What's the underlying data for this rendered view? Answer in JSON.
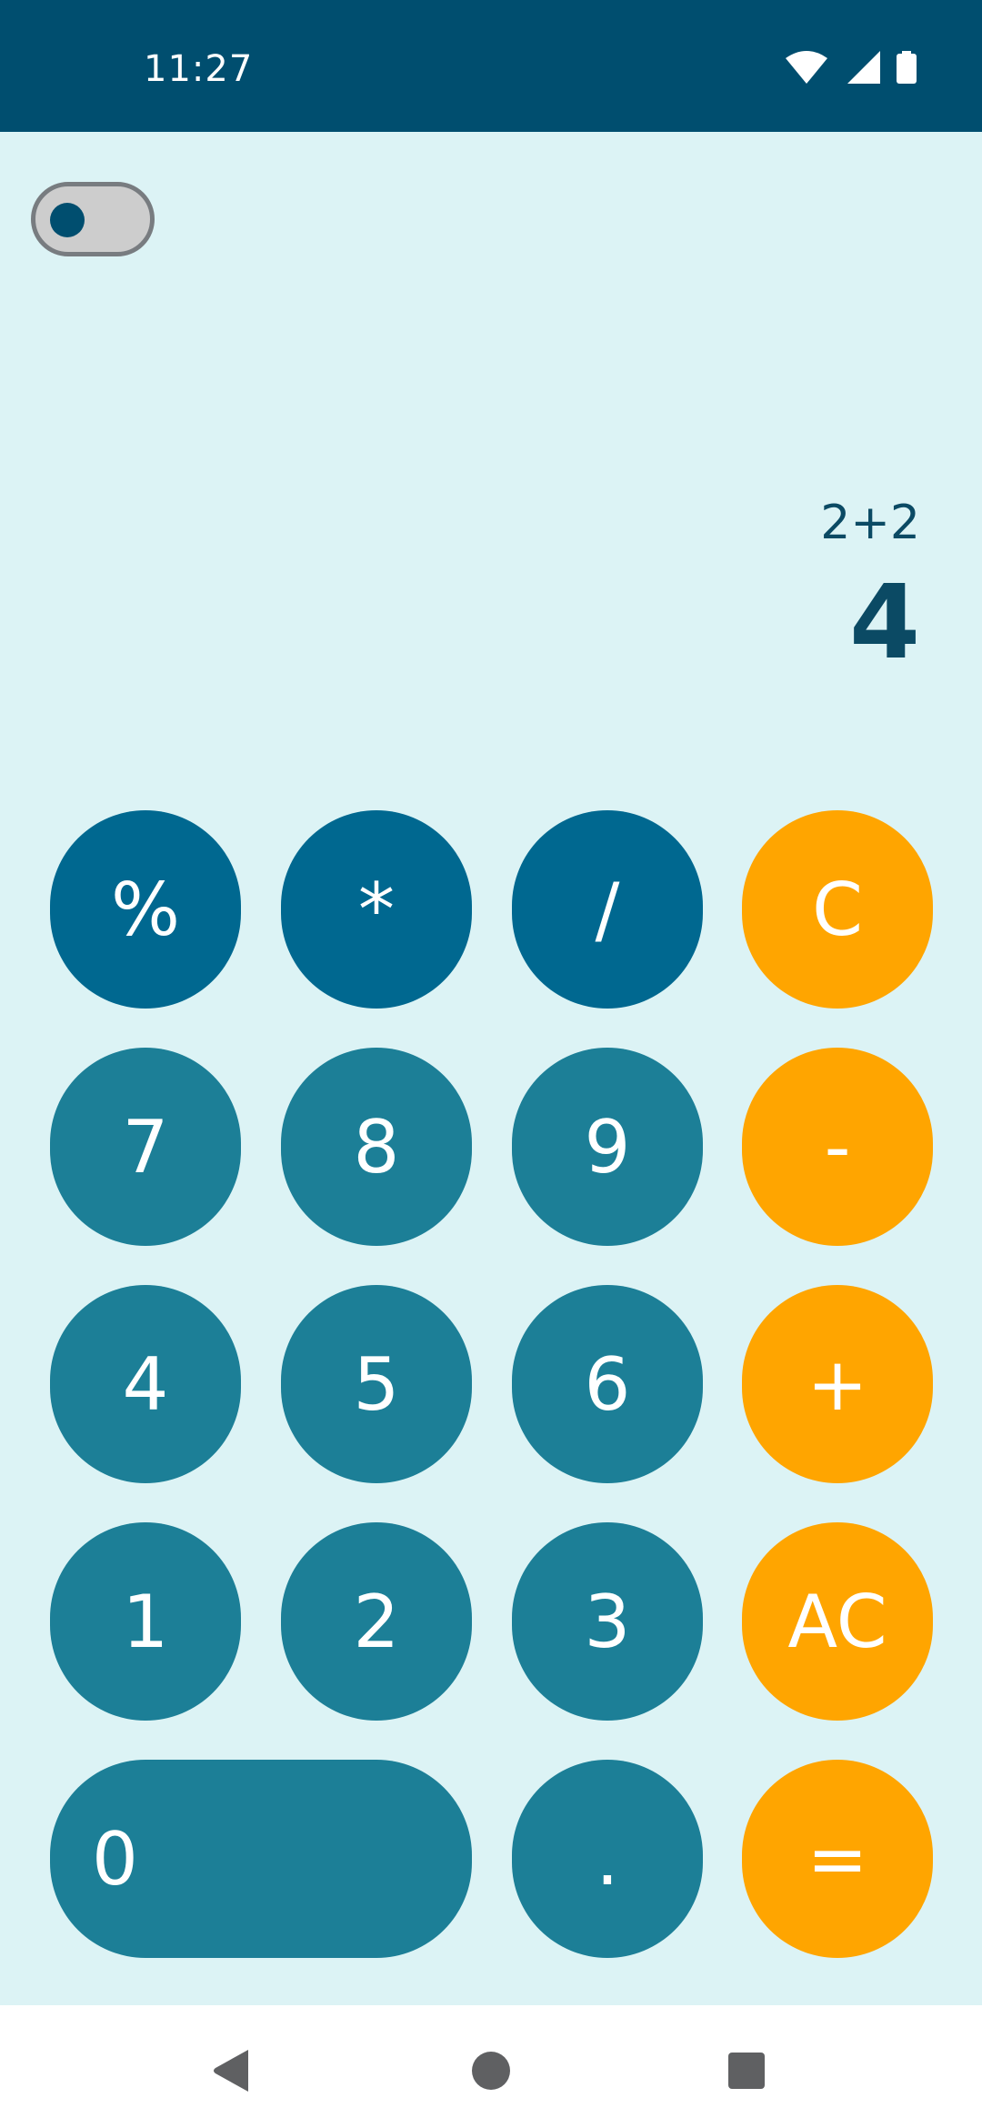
{
  "status_bar": {
    "time": "11:27",
    "icons": [
      "wifi-icon",
      "signal-icon",
      "battery-icon"
    ]
  },
  "theme_toggle": {
    "state": "off"
  },
  "display": {
    "expression": "2+2",
    "result": "4"
  },
  "keypad": {
    "percent": "%",
    "multiply": "*",
    "divide": "/",
    "clear": "C",
    "seven": "7",
    "eight": "8",
    "nine": "9",
    "minus": "-",
    "four": "4",
    "five": "5",
    "six": "6",
    "plus": "+",
    "one": "1",
    "two": "2",
    "three": "3",
    "all_clear": "AC",
    "zero": "0",
    "decimal": ".",
    "equals": "="
  },
  "nav_bar": {
    "icons": [
      "back-icon",
      "home-icon",
      "recents-icon"
    ]
  },
  "colors": {
    "status_bar": "#004e6f",
    "background": "#dcf3f5",
    "operator_key": "#006890",
    "number_key": "#1c7f97",
    "accent_key": "#ffa500",
    "display_text": "#0b4a64"
  }
}
